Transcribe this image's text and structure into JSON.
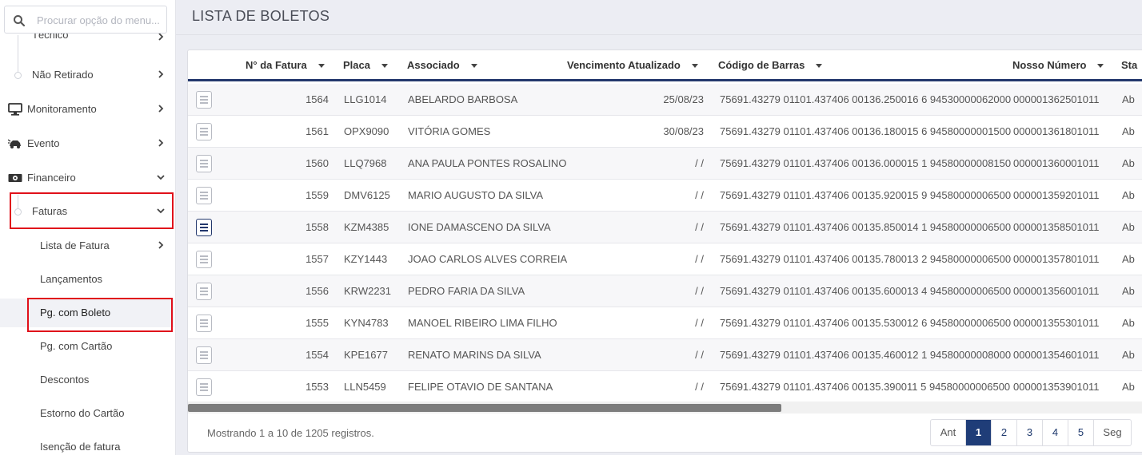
{
  "search": {
    "placeholder": "Procurar opção do menu..."
  },
  "sidebar": {
    "items": [
      {
        "label": "Técnico"
      },
      {
        "label": "Não Retirado"
      },
      {
        "label": "Monitoramento"
      },
      {
        "label": "Evento"
      },
      {
        "label": "Financeiro"
      },
      {
        "label": "Faturas"
      },
      {
        "label": "Lista de Fatura"
      },
      {
        "label": "Lançamentos"
      },
      {
        "label": "Pg. com Boleto"
      },
      {
        "label": "Pg. com Cartão"
      },
      {
        "label": "Descontos"
      },
      {
        "label": "Estorno do Cartão"
      },
      {
        "label": "Isenção de fatura"
      }
    ]
  },
  "page": {
    "title": "LISTA DE BOLETOS"
  },
  "table": {
    "columns": [
      "N° da Fatura",
      "Placa",
      "Associado",
      "Vencimento Atualizado",
      "Código de Barras",
      "Nosso Número",
      "Sta"
    ],
    "rows": [
      {
        "fatura": "1564",
        "placa": "LLG1014",
        "associado": "ABELARDO BARBOSA",
        "vencimento": "25/08/23",
        "codigo": "75691.43279 01101.437406 00136.250016 6 94530000062000",
        "nosso": "000001362501011",
        "status": "Ab"
      },
      {
        "fatura": "1561",
        "placa": "OPX9090",
        "associado": "VITÓRIA GOMES",
        "vencimento": "30/08/23",
        "codigo": "75691.43279 01101.437406 00136.180015 6 94580000001500",
        "nosso": "000001361801011",
        "status": "Ab"
      },
      {
        "fatura": "1560",
        "placa": "LLQ7968",
        "associado": "ANA PAULA PONTES ROSALINO",
        "vencimento": "/ /",
        "codigo": "75691.43279 01101.437406 00136.000015 1 94580000008150",
        "nosso": "000001360001011",
        "status": "Ab"
      },
      {
        "fatura": "1559",
        "placa": "DMV6125",
        "associado": "MARIO AUGUSTO DA SILVA",
        "vencimento": "/ /",
        "codigo": "75691.43279 01101.437406 00135.920015 9 94580000006500",
        "nosso": "000001359201011",
        "status": "Ab"
      },
      {
        "fatura": "1558",
        "placa": "KZM4385",
        "associado": "IONE DAMASCENO DA SILVA",
        "vencimento": "/ /",
        "codigo": "75691.43279 01101.437406 00135.850014 1 94580000006500",
        "nosso": "000001358501011",
        "status": "Ab"
      },
      {
        "fatura": "1557",
        "placa": "KZY1443",
        "associado": "JOAO CARLOS ALVES CORREIA",
        "vencimento": "/ /",
        "codigo": "75691.43279 01101.437406 00135.780013 2 94580000006500",
        "nosso": "000001357801011",
        "status": "Ab"
      },
      {
        "fatura": "1556",
        "placa": "KRW2231",
        "associado": "PEDRO FARIA DA SILVA",
        "vencimento": "/ /",
        "codigo": "75691.43279 01101.437406 00135.600013 4 94580000006500",
        "nosso": "000001356001011",
        "status": "Ab"
      },
      {
        "fatura": "1555",
        "placa": "KYN4783",
        "associado": "MANOEL RIBEIRO LIMA FILHO",
        "vencimento": "/ /",
        "codigo": "75691.43279 01101.437406 00135.530012 6 94580000006500",
        "nosso": "000001355301011",
        "status": "Ab"
      },
      {
        "fatura": "1554",
        "placa": "KPE1677",
        "associado": "RENATO MARINS DA SILVA",
        "vencimento": "/ /",
        "codigo": "75691.43279 01101.437406 00135.460012 1 94580000008000",
        "nosso": "000001354601011",
        "status": "Ab"
      },
      {
        "fatura": "1553",
        "placa": "LLN5459",
        "associado": "FELIPE OTAVIO DE SANTANA",
        "vencimento": "/ /",
        "codigo": "75691.43279 01101.437406 00135.390011 5 94580000006500",
        "nosso": "000001353901011",
        "status": "Ab"
      }
    ]
  },
  "footer": {
    "info": "Mostrando 1 a 10 de 1205 registros."
  },
  "pagination": {
    "prev": "Ant",
    "pages": [
      "1",
      "2",
      "3",
      "4",
      "5"
    ],
    "next": "Seg",
    "current": "1"
  },
  "colors": {
    "accent": "#1f3d78",
    "highlight": "#e0101a"
  }
}
